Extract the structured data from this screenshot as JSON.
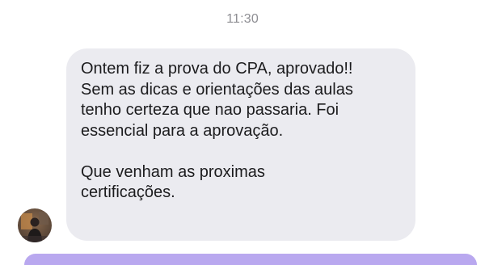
{
  "conversation": {
    "timestamp": "11:30",
    "message": {
      "paragraph1": [
        "Ontem fiz a prova do CPA, aprovado!!",
        "Sem as dicas e orientações das aulas",
        "tenho certeza que nao passaria. Foi",
        "essencial para a aprovação."
      ],
      "paragraph2": [
        "Que venham as proximas",
        "certificações."
      ]
    },
    "sender_avatar_icon": "user-photo-avatar"
  },
  "colors": {
    "received_bubble": "#ebebf0",
    "timestamp_text": "#8e8e93",
    "message_text": "#1c1c1e",
    "sent_bubble": "#b9a8ef"
  }
}
